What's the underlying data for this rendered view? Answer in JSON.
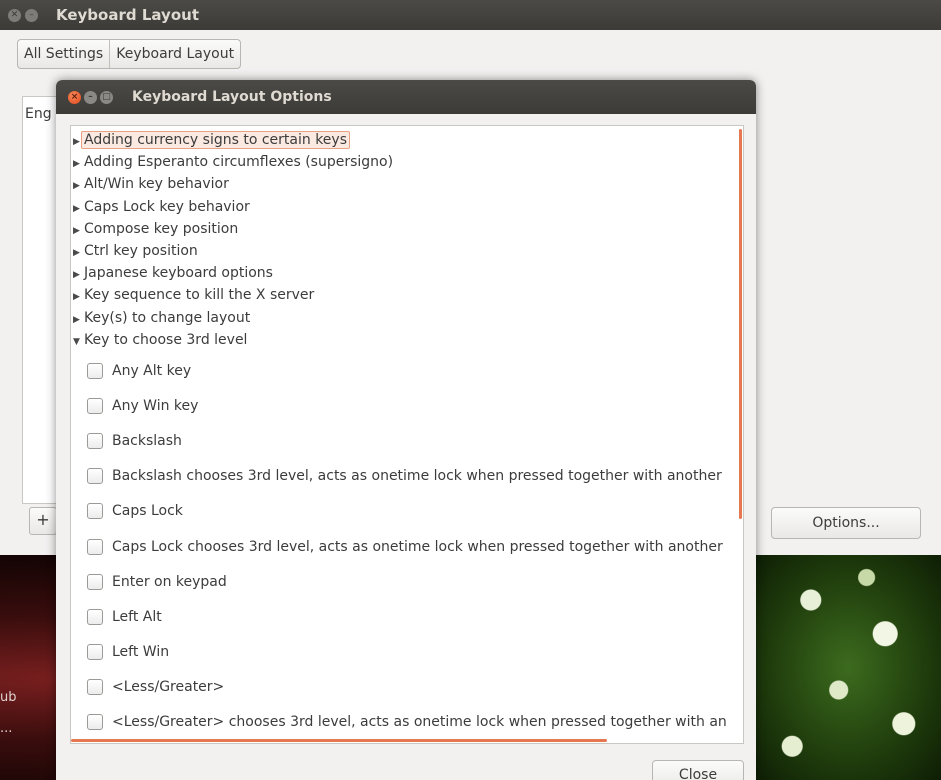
{
  "main_window": {
    "title": "Keyboard Layout",
    "breadcrumb": [
      "All Settings",
      "Keyboard Layout"
    ],
    "layout_list": [
      "Eng"
    ],
    "add_label": "+",
    "options_label": "Options..."
  },
  "dialog": {
    "title": "Keyboard Layout Options",
    "groups": [
      {
        "label": "Adding currency signs to certain keys",
        "expanded": false,
        "selected": true
      },
      {
        "label": "Adding Esperanto circumflexes (supersigno)",
        "expanded": false
      },
      {
        "label": "Alt/Win key behavior",
        "expanded": false
      },
      {
        "label": "Caps Lock key behavior",
        "expanded": false
      },
      {
        "label": "Compose key position",
        "expanded": false
      },
      {
        "label": "Ctrl key position",
        "expanded": false
      },
      {
        "label": "Japanese keyboard options",
        "expanded": false
      },
      {
        "label": "Key sequence to kill the X server",
        "expanded": false
      },
      {
        "label": "Key(s) to change layout",
        "expanded": false
      },
      {
        "label": "Key to choose 3rd level",
        "expanded": true
      }
    ],
    "options": [
      {
        "label": "Any Alt key",
        "checked": false
      },
      {
        "label": "Any Win key",
        "checked": false
      },
      {
        "label": "Backslash",
        "checked": false
      },
      {
        "label": "Backslash chooses 3rd level, acts as onetime lock when pressed together with another",
        "checked": false
      },
      {
        "label": "Caps Lock",
        "checked": false
      },
      {
        "label": "Caps Lock chooses 3rd level, acts as onetime lock when pressed together with another",
        "checked": false
      },
      {
        "label": "Enter on keypad",
        "checked": false
      },
      {
        "label": "Left Alt",
        "checked": false
      },
      {
        "label": "Left Win",
        "checked": false
      },
      {
        "label": "<Less/Greater>",
        "checked": false
      },
      {
        "label": "<Less/Greater> chooses 3rd level, acts as onetime lock when pressed together with an",
        "checked": false
      }
    ],
    "close_label": "Close",
    "collapsed_arrow": "▶",
    "expanded_arrow": "▼"
  },
  "desktop": {
    "edge_text_1": "ub",
    "edge_text_2": "..."
  },
  "colors": {
    "accent": "#e5784f",
    "titlebar": "#3c3b37",
    "window_bg": "#f2f1f0"
  }
}
